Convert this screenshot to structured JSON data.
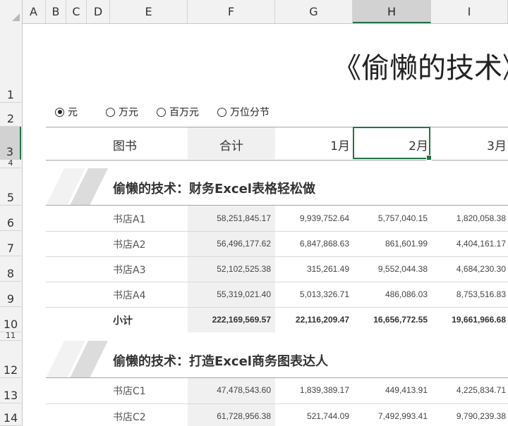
{
  "columns": [
    "A",
    "B",
    "C",
    "D",
    "E",
    "F",
    "G",
    "H",
    "I"
  ],
  "selected_column": "H",
  "rows": [
    "1",
    "2",
    "3",
    "4",
    "5",
    "6",
    "7",
    "8",
    "9",
    "10",
    "11",
    "12",
    "13",
    "14"
  ],
  "selected_row": "3",
  "title": "《偷懒的技术》",
  "units": {
    "options": [
      "元",
      "万元",
      "百万元",
      "万位分节"
    ],
    "selected": "元"
  },
  "header": {
    "book": "图书",
    "total": "合计",
    "m1": "1月",
    "m2": "2月",
    "m3": "3月"
  },
  "sections": [
    {
      "title": "偷懒的技术：财务Excel表格轻松做",
      "rows": [
        {
          "store": "书店A1",
          "total": "58,251,845.17",
          "m1": "9,939,752.64",
          "m2": "5,757,040.15",
          "m3": "1,820,058.38"
        },
        {
          "store": "书店A2",
          "total": "56,496,177.62",
          "m1": "6,847,868.63",
          "m2": "861,601.99",
          "m3": "4,404,161.17"
        },
        {
          "store": "书店A3",
          "total": "52,102,525.38",
          "m1": "315,261.49",
          "m2": "9,552,044.38",
          "m3": "4,684,230.30"
        },
        {
          "store": "书店A4",
          "total": "55,319,021.40",
          "m1": "5,013,326.71",
          "m2": "486,086.03",
          "m3": "8,753,516.83"
        }
      ],
      "subtotal": {
        "label": "小计",
        "total": "222,169,569.57",
        "m1": "22,116,209.47",
        "m2": "16,656,772.55",
        "m3": "19,661,966.68"
      }
    },
    {
      "title": "偷懒的技术：打造Excel商务图表达人",
      "rows": [
        {
          "store": "书店C1",
          "total": "47,478,543.60",
          "m1": "1,839,389.17",
          "m2": "449,413.91",
          "m3": "4,225,834.71"
        },
        {
          "store": "书店C2",
          "total": "61,728,956.38",
          "m1": "521,744.09",
          "m2": "7,492,993.41",
          "m3": "9,790,239.38"
        }
      ]
    }
  ],
  "colors": {
    "accent": "#217346",
    "total_column_fill": "#f0f0f0",
    "header_fill": "#f2f2f2"
  }
}
